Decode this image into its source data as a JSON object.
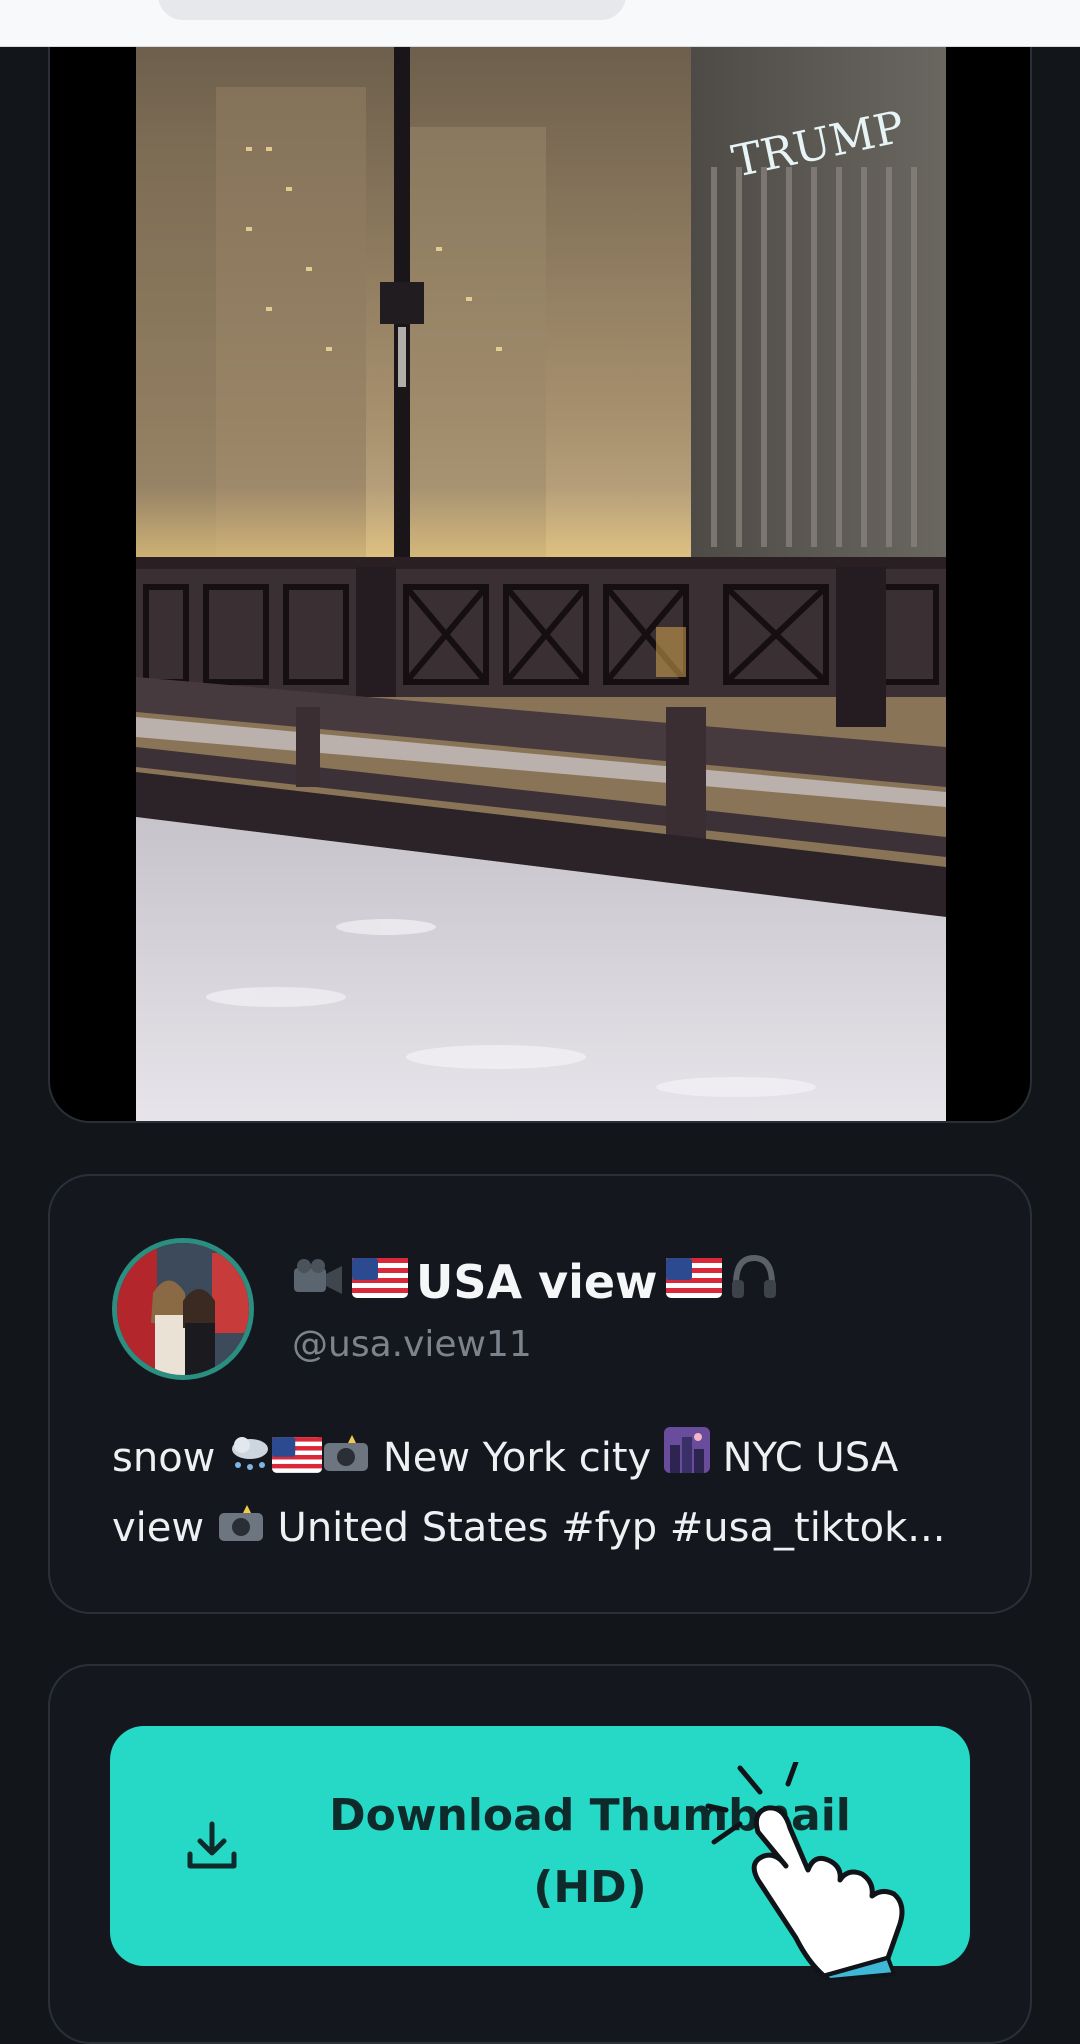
{
  "browser": {},
  "video": {
    "thumbnail_alt": "Snowy bridge at night with city skyline",
    "building_sign": "TRUMP"
  },
  "profile": {
    "display_name": "USA view",
    "username": "@usa.view11",
    "caption_line1_a": "snow",
    "caption_line1_b": "New York city",
    "caption_line1_c": "NYC USA",
    "caption_line2_a": "view",
    "caption_line2_b": "United States #fyp #usa_tiktok..."
  },
  "download": {
    "button_label_line1": "Download Thumbnail",
    "button_label_line2": "(HD)",
    "icon": "download-icon"
  },
  "colors": {
    "accent": "#26d9c6",
    "background": "#12161b",
    "card": "#14181e"
  }
}
